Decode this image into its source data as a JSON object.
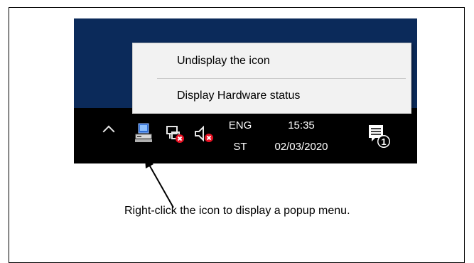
{
  "context_menu": {
    "items": [
      {
        "label": "Undisplay the icon"
      },
      {
        "label": "Display Hardware status"
      }
    ]
  },
  "taskbar": {
    "language": {
      "line1": "ENG",
      "line2": "ST"
    },
    "clock": {
      "time": "15:35",
      "date": "02/03/2020"
    },
    "notification_count": "1",
    "icons": [
      "chevron-up-icon",
      "hardware-status-icon",
      "network-disconnected-icon",
      "volume-muted-icon",
      "action-center-icon"
    ]
  },
  "annotation": {
    "caption": "Right-click the icon to display a popup menu."
  },
  "colors": {
    "desktop": "#0b2a5a",
    "taskbar": "#000000",
    "menu_bg": "#f2f2f2",
    "error_red": "#e81123"
  }
}
